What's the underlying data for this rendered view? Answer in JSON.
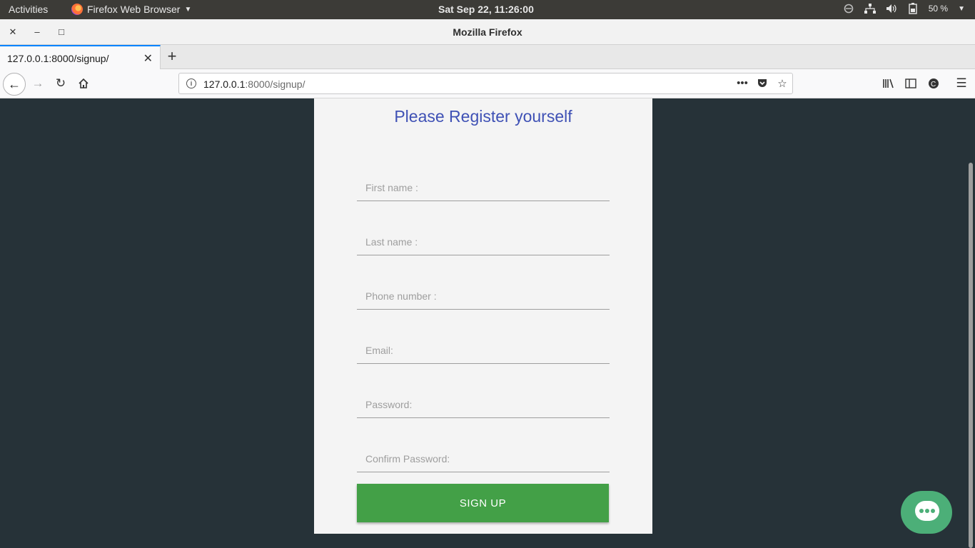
{
  "system_bar": {
    "activities": "Activities",
    "app_name": "Firefox Web Browser",
    "clock": "Sat Sep 22, 11:26:00",
    "battery": "50 %"
  },
  "window": {
    "title": "Mozilla Firefox"
  },
  "tabs": [
    {
      "label": "127.0.0.1:8000/signup/",
      "active": true
    }
  ],
  "urlbar": {
    "host": "127.0.0.1",
    "path": ":8000/signup/"
  },
  "form": {
    "heading": "Please Register yourself",
    "fields": {
      "first_name": "First name :",
      "last_name": "Last name :",
      "phone": "Phone number :",
      "email": "Email:",
      "password": "Password:",
      "confirm_password": "Confirm Password:"
    },
    "submit_label": "SIGN UP"
  },
  "colors": {
    "page_background": "#263238",
    "heading": "#3f51b5",
    "button": "#43a047",
    "chat_button": "#4caf78"
  },
  "icons": [
    "firefox-icon",
    "network-icon",
    "volume-icon",
    "battery-icon",
    "back-arrow-icon",
    "forward-arrow-icon",
    "reload-icon",
    "home-icon",
    "info-icon",
    "more-icon",
    "pocket-icon",
    "star-icon",
    "library-icon",
    "sidebar-icon",
    "extension-icon",
    "menu-icon",
    "chat-icon"
  ]
}
